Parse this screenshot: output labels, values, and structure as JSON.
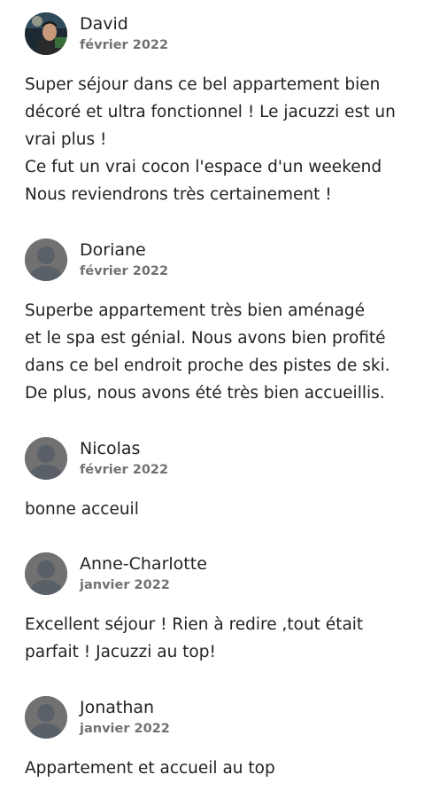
{
  "reviews": [
    {
      "name": "David",
      "date": "février 2022",
      "avatar": "user-photo",
      "lines": [
        "Super séjour dans ce bel appartement bien",
        "décoré et ultra fonctionnel ! Le jacuzzi est un",
        "vrai plus !",
        "Ce fut un vrai cocon l'espace d'un weekend",
        "Nous reviendrons très certainement !"
      ]
    },
    {
      "name": "Doriane",
      "date": "février 2022",
      "avatar": "default-user-icon",
      "lines": [
        "Superbe appartement très bien aménagé",
        "et le spa est génial. Nous avons bien profité",
        "dans ce bel endroit proche des pistes de ski.",
        "De plus, nous avons été très bien accueillis."
      ]
    },
    {
      "name": "Nicolas",
      "date": "février 2022",
      "avatar": "default-user-icon",
      "lines": [
        "bonne acceuil"
      ]
    },
    {
      "name": "Anne-Charlotte",
      "date": "janvier 2022",
      "avatar": "default-user-icon",
      "lines": [
        "Excellent séjour ! Rien à redire ,tout était",
        "parfait ! Jacuzzi au top!"
      ]
    },
    {
      "name": "Jonathan",
      "date": "janvier 2022",
      "avatar": "default-user-icon",
      "lines": [
        "Appartement et accueil au top"
      ]
    }
  ],
  "colors": {
    "text": "#222222",
    "muted": "#717171",
    "avatar_bg": "#717171",
    "avatar_fg": "#5a6068"
  }
}
